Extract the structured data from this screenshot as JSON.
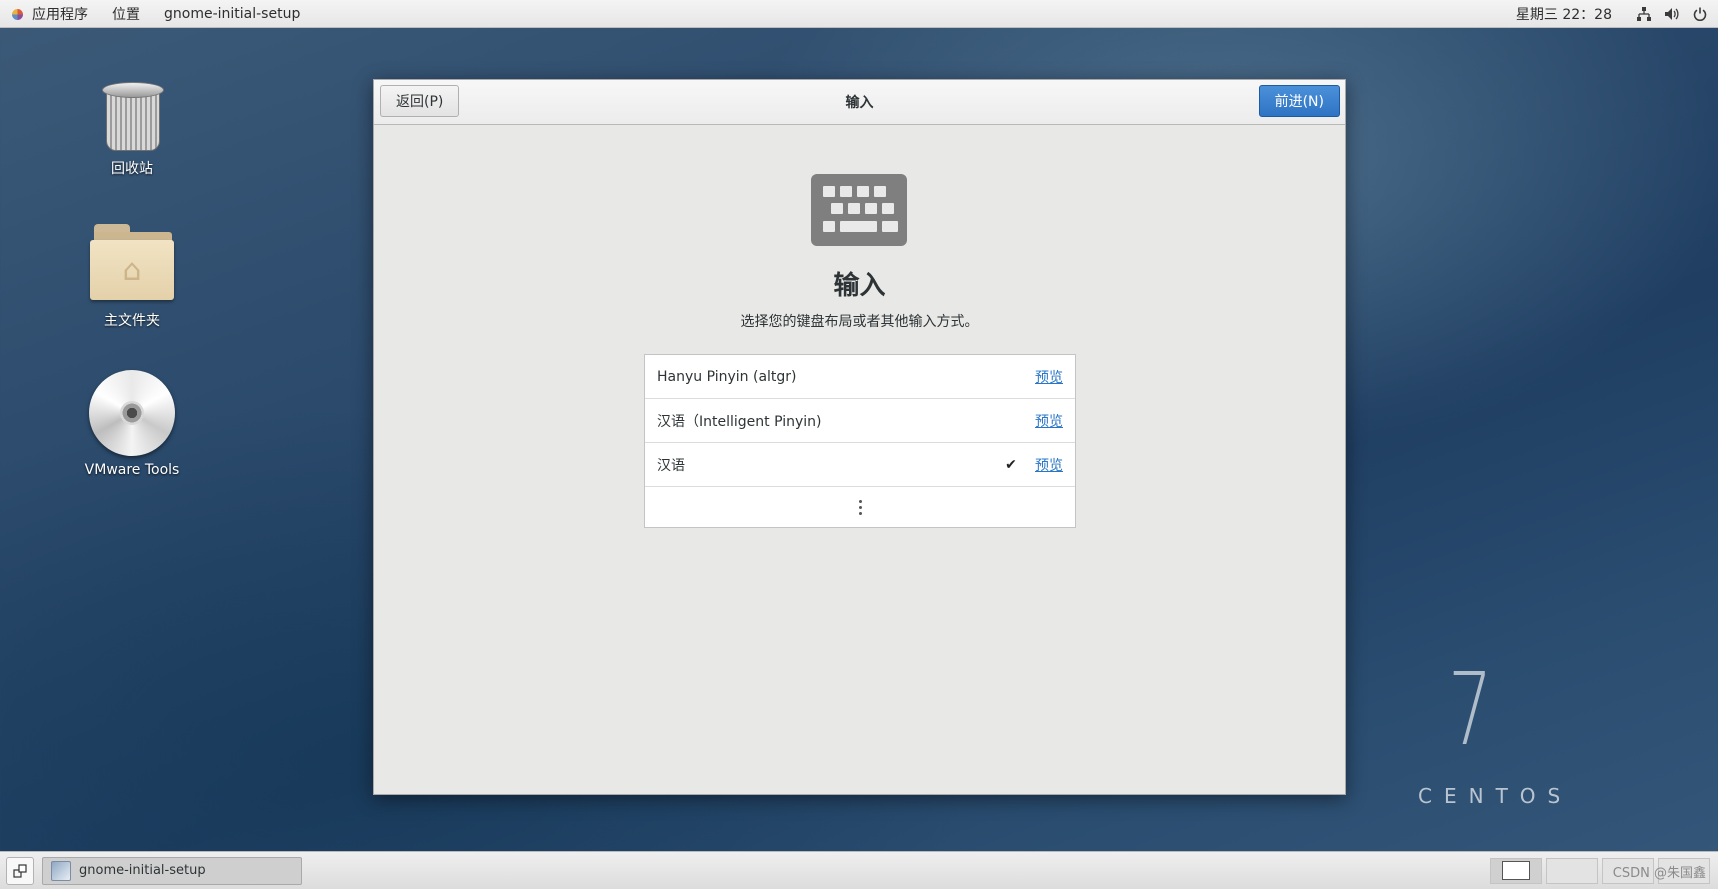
{
  "top_panel": {
    "applications_label": "应用程序",
    "places_label": "位置",
    "window_menu_label": "gnome-initial-setup",
    "clock": "星期三 22：28",
    "tray_icons": [
      "network-icon",
      "volume-icon",
      "power-icon"
    ]
  },
  "desktop": {
    "icons": [
      {
        "label": "回收站",
        "icon": "trash-icon"
      },
      {
        "label": "主文件夹",
        "icon": "home-folder-icon"
      },
      {
        "label": "VMware Tools",
        "icon": "disc-icon"
      }
    ]
  },
  "window": {
    "title": "输入",
    "back_label": "返回(P)",
    "next_label": "前进(N)",
    "heading": "输入",
    "subheading": "选择您的键盘布局或者其他输入方式。",
    "input_sources": [
      {
        "label": "Hanyu Pinyin (altgr)",
        "selected": false,
        "preview": "预览"
      },
      {
        "label": "汉语（Intelligent Pinyin)",
        "selected": true,
        "preview": "预览"
      },
      {
        "label": "汉语",
        "selected": true,
        "preview": "预览"
      }
    ],
    "accent_color": "#2f74c4"
  },
  "branding": {
    "version": "7",
    "name": "CENTOS"
  },
  "bottom_panel": {
    "task_label": "gnome-initial-setup",
    "watermark": "CSDN @朱国鑫"
  }
}
